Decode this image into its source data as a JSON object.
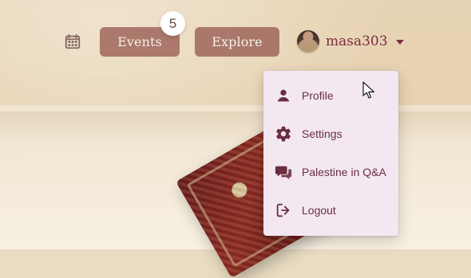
{
  "nav": {
    "events_label": "Events",
    "events_badge": "5",
    "explore_label": "Explore",
    "username": "masa303"
  },
  "menu": {
    "items": [
      {
        "label": "Profile",
        "icon": "person-icon"
      },
      {
        "label": "Settings",
        "icon": "gear-icon"
      },
      {
        "label": "Palestine in Q&A",
        "icon": "forum-icon"
      },
      {
        "label": "Logout",
        "icon": "logout-icon"
      }
    ]
  },
  "colors": {
    "nav_button_bg": "#9f665a",
    "accent_text": "#7a2e3f",
    "menu_bg": "#f3e8f2"
  }
}
